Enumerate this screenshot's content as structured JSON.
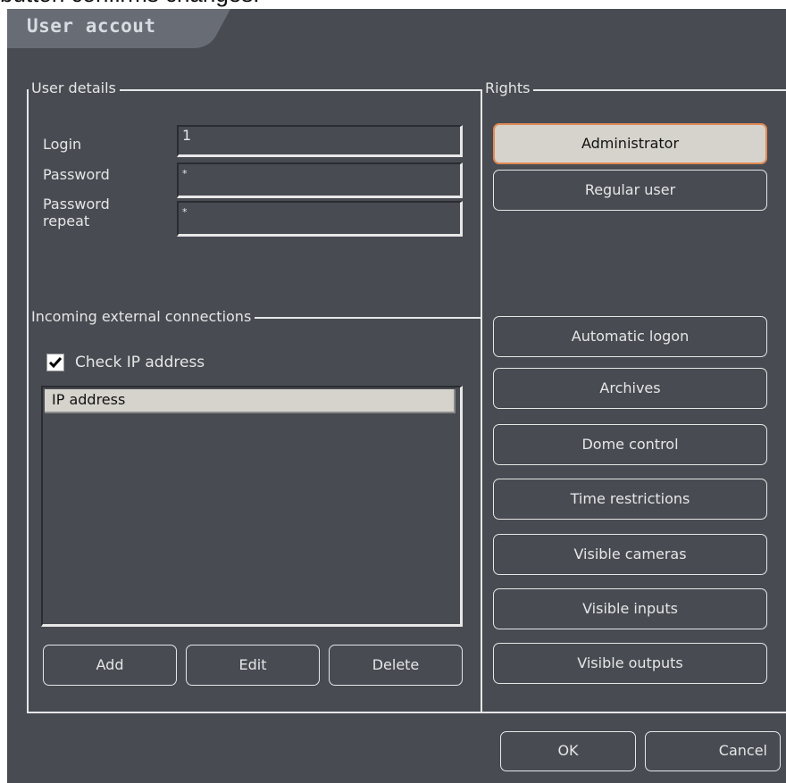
{
  "caption": "button confirms changes.",
  "window": {
    "title": "User accout"
  },
  "user_details": {
    "legend": "User details",
    "login_label": "Login",
    "login_value": "1",
    "password_label": "Password",
    "password_value": "*",
    "password_repeat_label_line1": "Password",
    "password_repeat_label_line2": "repeat",
    "password_repeat_value": "*"
  },
  "incoming": {
    "legend": "Incoming external connections",
    "check_ip_label": "Check IP address",
    "check_ip_checked": true,
    "column_header": "IP address",
    "add_label": "Add",
    "edit_label": "Edit",
    "delete_label": "Delete"
  },
  "rights": {
    "legend": "Rights",
    "administrator_label": "Administrator",
    "regular_user_label": "Regular user",
    "selected": "Administrator",
    "buttons": [
      "Automatic logon",
      "Archives",
      "Dome control",
      "Time restrictions",
      "Visible cameras",
      "Visible inputs",
      "Visible outputs"
    ]
  },
  "footer": {
    "ok_label": "OK",
    "cancel_label": "Cancel"
  },
  "colors": {
    "dialog_bg": "#484b52",
    "title_tab": "#686c75",
    "selected_button": "#d6d3cd",
    "selected_border": "#e08a55"
  }
}
